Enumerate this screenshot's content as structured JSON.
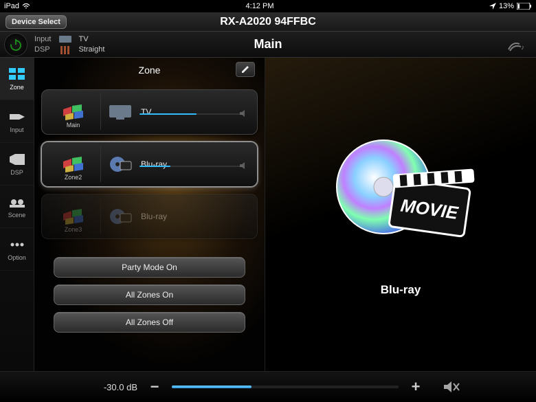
{
  "statusbar": {
    "carrier": "iPad",
    "time": "4:12 PM",
    "battery": "13%"
  },
  "titlebar": {
    "device_select": "Device Select",
    "title": "RX-A2020 94FFBC"
  },
  "infobar": {
    "input_label": "Input",
    "input_value": "TV",
    "dsp_label": "DSP",
    "dsp_value": "Straight",
    "zone_title": "Main"
  },
  "sidebar": {
    "items": [
      {
        "label": "Zone",
        "active": true
      },
      {
        "label": "Input",
        "active": false
      },
      {
        "label": "DSP",
        "active": false
      },
      {
        "label": "Scene",
        "active": false
      },
      {
        "label": "Option",
        "active": false
      }
    ]
  },
  "zone": {
    "header": "Zone",
    "cards": [
      {
        "name": "Main",
        "input": "TV",
        "vol_pct": 55,
        "state": "normal"
      },
      {
        "name": "Zone2",
        "input": "Blu-ray",
        "vol_pct": 30,
        "state": "selected"
      },
      {
        "name": "Zone3",
        "input": "Blu-ray",
        "vol_pct": 0,
        "state": "disabled"
      }
    ],
    "actions": {
      "party": "Party Mode On",
      "all_on": "All Zones On",
      "all_off": "All Zones Off"
    }
  },
  "content": {
    "label": "Blu-ray",
    "art": "movie"
  },
  "volume": {
    "db": "-30.0 dB",
    "pct": 35
  }
}
